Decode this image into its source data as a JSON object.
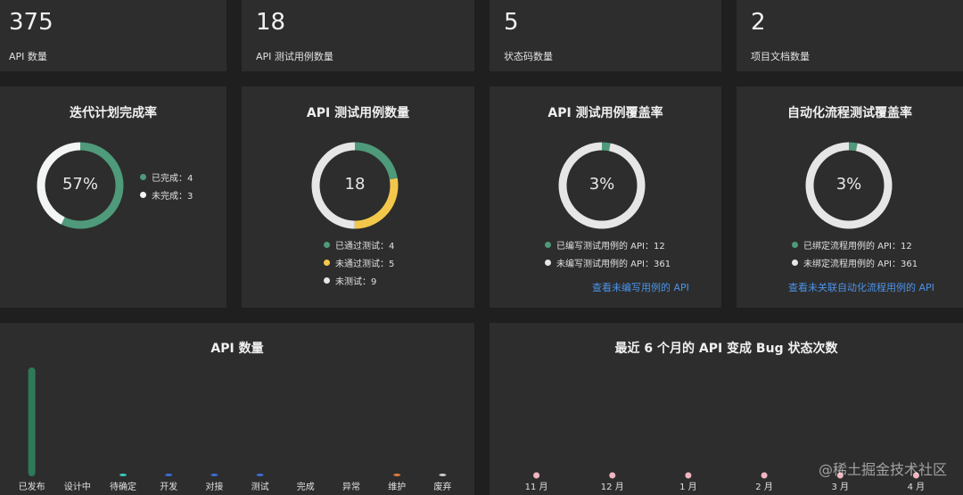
{
  "stats": [
    {
      "value": "375",
      "label": "API 数量"
    },
    {
      "value": "18",
      "label": "API 测试用例数量"
    },
    {
      "value": "5",
      "label": "状态码数量"
    },
    {
      "value": "2",
      "label": "项目文档数量"
    }
  ],
  "iteration": {
    "title": "迭代计划完成率",
    "center": "57%",
    "legend": [
      "已完成：4",
      "未完成：3"
    ],
    "colors": [
      "#4e9a7a",
      "#f2f5f3"
    ]
  },
  "testcases": {
    "title": "API 测试用例数量",
    "center": "18",
    "legend": [
      "已通过测试：4",
      "未通过测试：5",
      "未测试：9"
    ],
    "colors": [
      "#4e9a7a",
      "#f3c84a",
      "#e6e6e6"
    ]
  },
  "coverage": {
    "title": "API 测试用例覆盖率",
    "center": "3%",
    "legend": [
      "已编写测试用例的 API：12",
      "未编写测试用例的 API：361"
    ],
    "link": "查看未编写用例的 API",
    "colors": [
      "#4e9a7a",
      "#e6e6e6"
    ]
  },
  "auto_coverage": {
    "title": "自动化流程测试覆盖率",
    "center": "3%",
    "legend": [
      "已绑定流程用例的 API：12",
      "未绑定流程用例的 API：361"
    ],
    "link": "查看未关联自动化流程用例的 API",
    "colors": [
      "#4e9a7a",
      "#e6e6e6"
    ]
  },
  "api_chart": {
    "title": "API 数量"
  },
  "bug_chart": {
    "title": "最近 6 个月的 API 变成 Bug 状态次数"
  },
  "chart_data": [
    {
      "type": "pie",
      "categories": [
        "已完成",
        "未完成"
      ],
      "values": [
        4,
        3
      ]
    },
    {
      "type": "pie",
      "categories": [
        "已通过测试",
        "未通过测试",
        "未测试"
      ],
      "values": [
        4,
        5,
        9
      ]
    },
    {
      "type": "pie",
      "categories": [
        "已编写测试用例的 API",
        "未编写测试用例的 API"
      ],
      "values": [
        12,
        361
      ]
    },
    {
      "type": "pie",
      "categories": [
        "已绑定流程用例的 API",
        "未绑定流程用例的 API"
      ],
      "values": [
        12,
        361
      ]
    },
    {
      "type": "bar",
      "title": "API 数量",
      "categories": [
        "已发布",
        "设计中",
        "待确定",
        "开发",
        "对接",
        "测试",
        "完成",
        "异常",
        "维护",
        "废弃"
      ],
      "values": [
        352,
        0,
        1,
        1,
        8,
        6,
        0,
        0,
        1,
        1
      ],
      "colors": [
        "#2e7a58",
        "#7a4fd8",
        "#3cc9c0",
        "#3a6fd8",
        "#3a6fd8",
        "#3a6fd8",
        "#3a6fd8",
        "#3a6fd8",
        "#e07b3a",
        "#cccccc"
      ]
    },
    {
      "type": "line",
      "title": "最近 6 个月的 API 变成 Bug 状态次数",
      "categories": [
        "11 月",
        "12 月",
        "1 月",
        "2 月",
        "3 月",
        "4 月"
      ],
      "values": [
        0,
        0,
        0,
        0,
        0,
        0
      ]
    }
  ],
  "watermark": "@稀土掘金技术社区"
}
